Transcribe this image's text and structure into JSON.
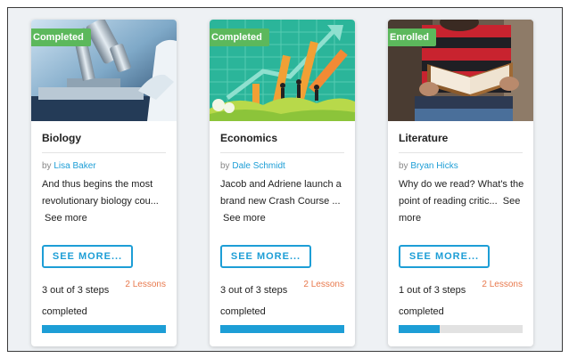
{
  "courses": [
    {
      "badge": "Completed",
      "badge_color": "#5cb85c",
      "image_icon": "microscope-icon",
      "title": "Biology",
      "author_prefix": "by",
      "author": "Lisa Baker",
      "description": "And thus begins the most revolutionary biology cou...",
      "see_more_link": "See more",
      "button": "SEE MORE...",
      "steps": "3 out of 3 steps completed",
      "lessons": "2 Lessons",
      "progress": 1.0
    },
    {
      "badge": "Completed",
      "badge_color": "#5cb85c",
      "image_icon": "economics-chart-icon",
      "title": "Economics",
      "author_prefix": "by",
      "author": "Dale Schmidt",
      "description": "Jacob and Adriene launch a brand new Crash Course ...",
      "see_more_link": "See more",
      "button": "SEE MORE...",
      "steps": "3 out of 3 steps completed",
      "lessons": "2 Lessons",
      "progress": 1.0
    },
    {
      "badge": "Enrolled",
      "badge_color": "#5cb85c",
      "image_icon": "reading-book-icon",
      "title": "Literature",
      "author_prefix": "by",
      "author": "Bryan Hicks",
      "description": "Why do we read? What's the point of reading critic...",
      "see_more_link": "See more",
      "button": "SEE MORE...",
      "steps": "1 out of 3 steps completed",
      "lessons": "2 Lessons",
      "progress": 0.33
    }
  ],
  "colors": {
    "accent": "#1d9ed6",
    "lessons": "#e8794d",
    "badge": "#5cb85c"
  }
}
